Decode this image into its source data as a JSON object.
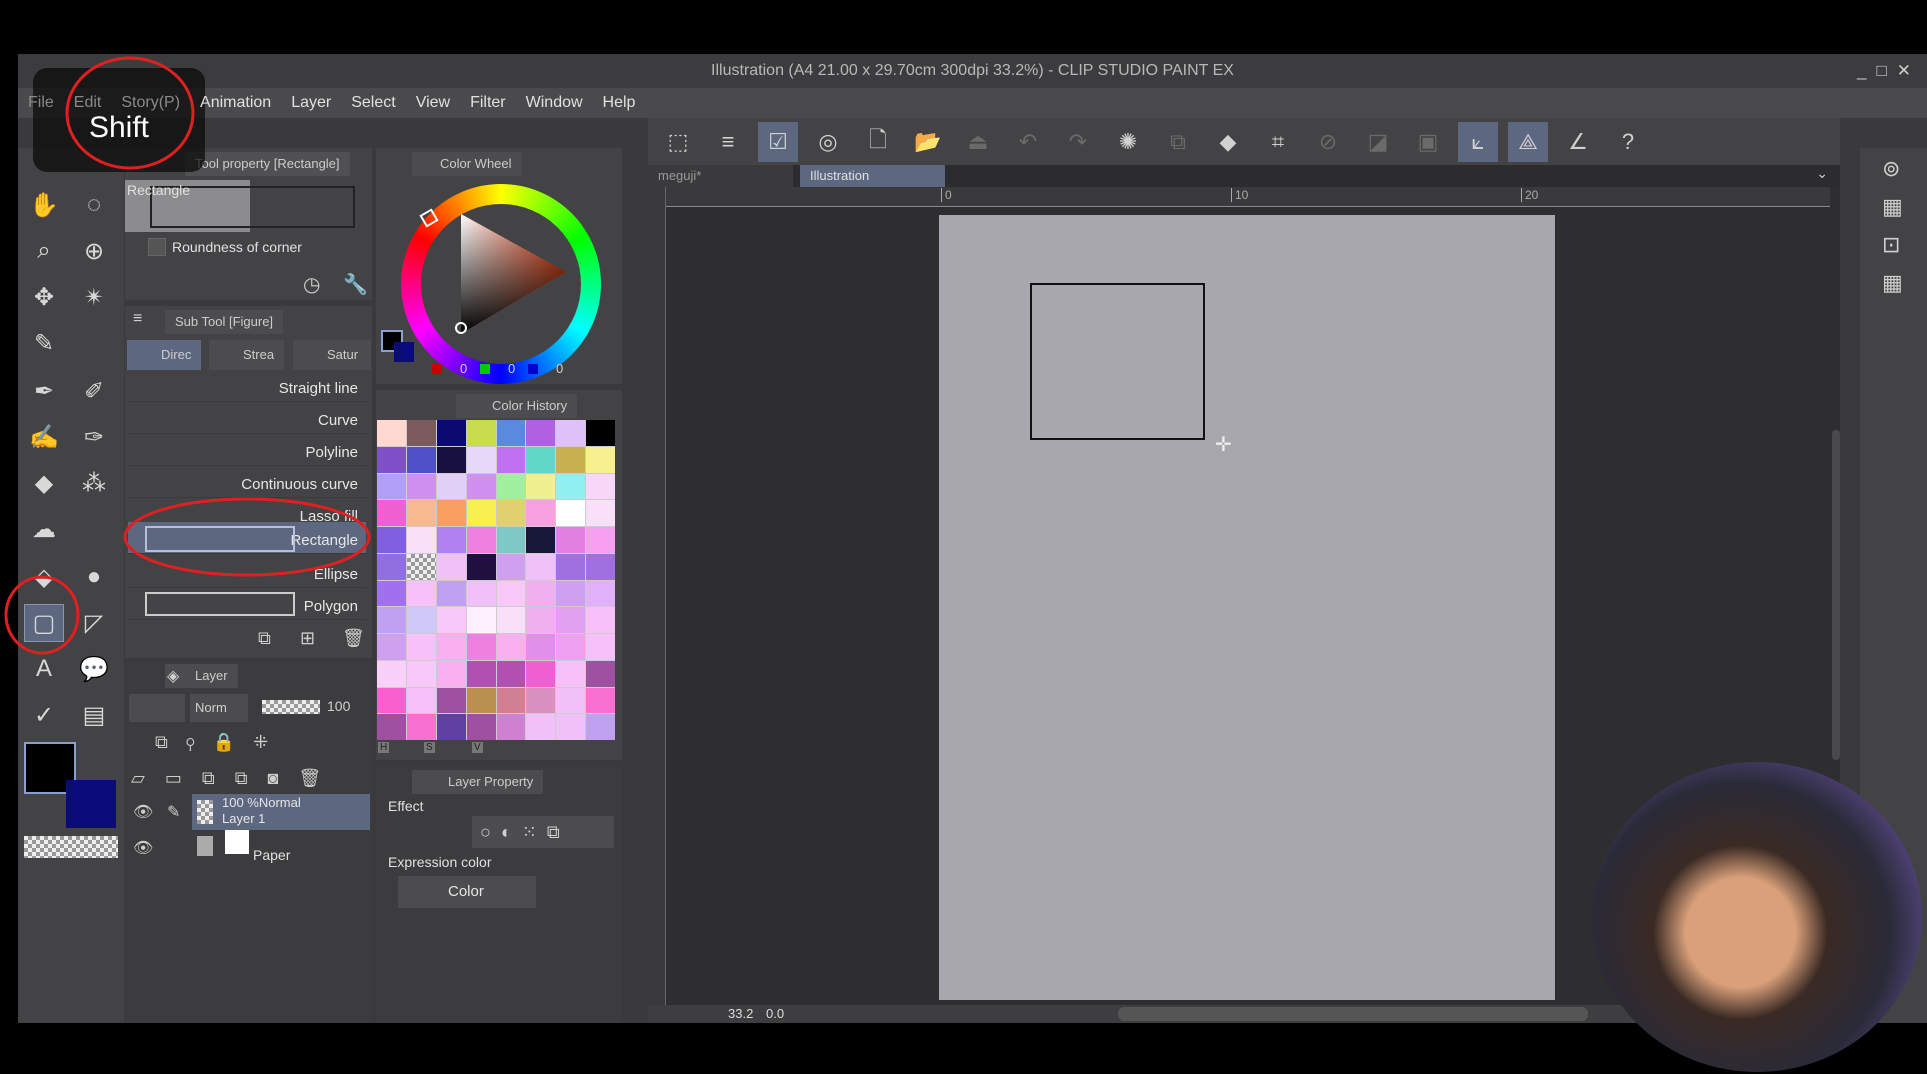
{
  "window": {
    "title": "Illustration (A4 21.00 x 29.70cm 300dpi 33.2%)  - CLIP STUDIO PAINT EX",
    "controls": [
      "_",
      "□",
      "✕"
    ]
  },
  "menu": [
    "File",
    "Edit",
    "Story(P)",
    "Animation",
    "Layer",
    "Select",
    "View",
    "Filter",
    "Window",
    "Help"
  ],
  "overlay": {
    "key": "Shift"
  },
  "tool_property": {
    "title": "Tool property [Rectangle]",
    "preview_label": "Rectangle",
    "roundness_label": "Roundness of corner"
  },
  "sub_tool": {
    "title": "Sub Tool [Figure]",
    "tabs": [
      "Direc",
      "Strea",
      "Satur"
    ],
    "items": [
      "Straight line",
      "Curve",
      "Polyline",
      "Continuous curve",
      "Lasso fill",
      "Rectangle",
      "Ellipse",
      "Polygon"
    ],
    "selected": "Rectangle"
  },
  "color_wheel": {
    "title": "Color Wheel",
    "r": "0",
    "g": "0",
    "b": "0",
    "main_color": "#000000",
    "sub_color": "#0a0a78"
  },
  "color_history": {
    "title": "Color History",
    "hsv_labels": [
      "H",
      "S",
      "V"
    ],
    "swatches": [
      "#ffd8d0",
      "#7a5a5a",
      "#0a0a70",
      "#c8dc50",
      "#5a8ae0",
      "#b060e0",
      "#e0c0f8",
      "#000000",
      "#8050c8",
      "#5050c8",
      "#181040",
      "#e8d8f8",
      "#c070f0",
      "#60d8c8",
      "#c8b050",
      "#f8f090",
      "#b0a0f8",
      "#d090f0",
      "#e0d0f8",
      "#d090f0",
      "#a0f0a0",
      "#f0f090",
      "#90f0f0",
      "#f8d8f8",
      "#f060d0",
      "#f8b890",
      "#f8a060",
      "#f8f050",
      "#e0d070",
      "#f8a0e0",
      "#ffffff",
      "#f8e0f8",
      "#8060e0",
      "#f8e0f8",
      "#b080f0",
      "#f080e0",
      "#80c8c8",
      "#181838",
      "#e080e0",
      "#f8a0f0",
      "#9070e0",
      "checker",
      "#f0c0f8",
      "#201040",
      "#d0a0f0",
      "#f0c0f8",
      "#a070e0",
      "#a070e0",
      "#a070f0",
      "#f8c0f8",
      "#c0a0f0",
      "#f0c0f8",
      "#f8c8f8",
      "#f0b0f0",
      "#d0a0f0",
      "#e0b0f8",
      "#c0a0f0",
      "#d0c8f8",
      "#f8c8f8",
      "#fff0ff",
      "#f8e0f8",
      "#f0b0f0",
      "#e0a0f0",
      "#f8c0f8",
      "#d0a0f0",
      "#f8c0f8",
      "#f8b0f0",
      "#f080e0",
      "#f8b0f0",
      "#e090e8",
      "#f0a0f0",
      "#f8c0f8",
      "#f8d0f8",
      "#f8c8f8",
      "#f8b0f0",
      "#b050b0",
      "#b050b0",
      "#f060d0",
      "#f8c0f8",
      "#a050a0",
      "#f860d0",
      "#f8c0f8",
      "#a050a0",
      "#b89050",
      "#d08090",
      "#d890c0",
      "#f0c0f8",
      "#f870d0",
      "#a050a0",
      "#f870d0",
      "#6040a0",
      "#a050a0",
      "#d080d0",
      "#f0c0f8",
      "#f0c0f8",
      "#c0a0f0"
    ]
  },
  "layer_panel": {
    "title": "Layer",
    "blend_mode": "Norm",
    "opacity": "100",
    "layers": [
      {
        "mode": "100 %Normal",
        "name": "Layer 1",
        "selected": true
      },
      {
        "mode": "",
        "name": "Paper",
        "selected": false
      }
    ]
  },
  "layer_property": {
    "title": "Layer Property",
    "effect_label": "Effect",
    "expression_label": "Expression color",
    "expression_value": "Color"
  },
  "canvas": {
    "tabs": [
      {
        "label": "meguji*",
        "active": false
      },
      {
        "label": "Illustration",
        "active": true
      }
    ],
    "ruler_ticks": [
      "0",
      "10",
      "20"
    ],
    "zoom": "33.2",
    "rotation": "0.0"
  },
  "colors": {
    "accent": "#5d6780",
    "annotation": "#e02020",
    "paper": "#a8a7ad"
  }
}
